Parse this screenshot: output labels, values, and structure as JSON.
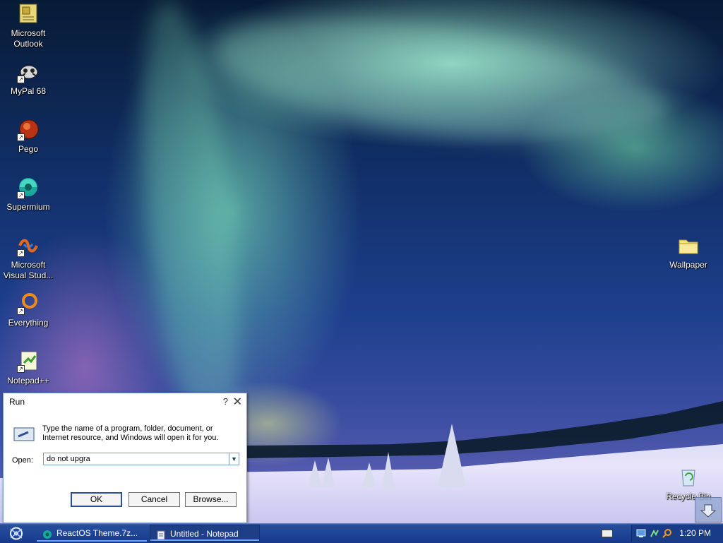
{
  "desktop": {
    "icons": [
      {
        "label": "Microsoft\nOutlook",
        "icon": "outlook-icon"
      },
      {
        "label": "MyPal 68",
        "icon": "mypal-icon"
      },
      {
        "label": "Pego",
        "icon": "pego-icon"
      },
      {
        "label": "Supermium",
        "icon": "supermium-icon"
      },
      {
        "label": "Microsoft\nVisual Stud...",
        "icon": "visual-studio-icon"
      },
      {
        "label": "Everything",
        "icon": "everything-icon"
      },
      {
        "label": "Notepad++",
        "icon": "notepadpp-icon"
      },
      {
        "label": "Wallpaper",
        "icon": "folder-icon"
      },
      {
        "label": "Recycle Bin",
        "icon": "recycle-bin-icon"
      }
    ]
  },
  "run_dialog": {
    "title": "Run",
    "help": "?",
    "close": "✕",
    "description": "Type the name of a program, folder, document, or Internet resource, and Windows will open it for you.",
    "open_label": "Open:",
    "input_value": "do not upgra",
    "ok_label": "OK",
    "cancel_label": "Cancel",
    "browse_label": "Browse..."
  },
  "taskbar": {
    "tasks": [
      {
        "label": "ReactOS Theme.7z...",
        "icon": "supermium-icon",
        "active": false
      },
      {
        "label": "Untitled - Notepad",
        "icon": "notepad-icon",
        "active": true
      }
    ],
    "clock": "1:20 PM"
  },
  "colors": {
    "taskbar": "#1f4597",
    "dialog_border": "#7a9ad1",
    "ok_border": "#2c4e9c"
  }
}
